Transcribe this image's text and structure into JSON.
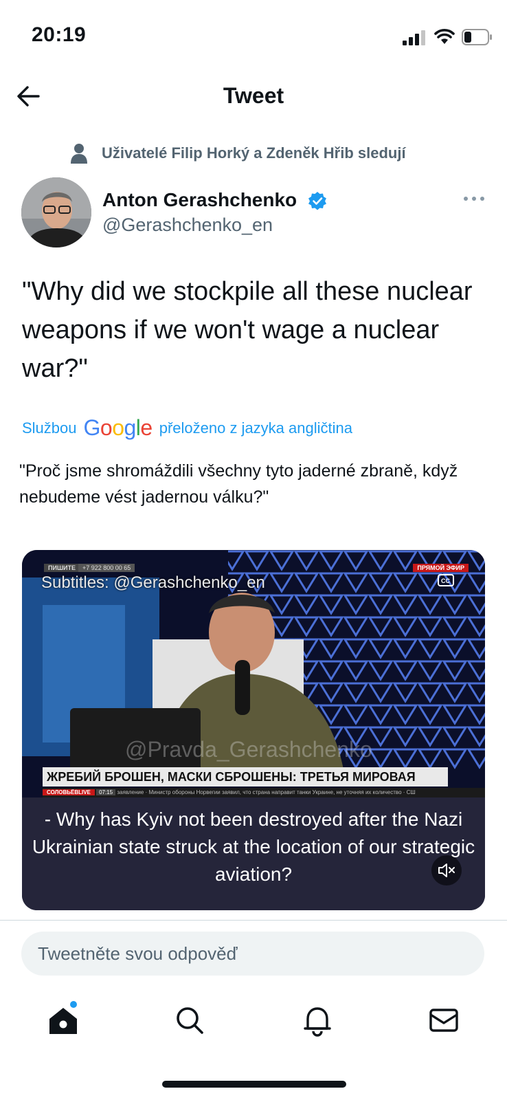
{
  "status_bar": {
    "time": "20:19",
    "icons": [
      "signal-icon",
      "wifi-icon",
      "battery-icon"
    ]
  },
  "header": {
    "title": "Tweet",
    "back_icon": "arrow-left-icon"
  },
  "social_context": {
    "icon": "person-icon",
    "text": "Uživatelé Filip Horký a Zdeněk Hřib sledují"
  },
  "author": {
    "name": "Anton Gerashchenko",
    "handle": "@Gerashchenko_en",
    "verified": true
  },
  "tweet": {
    "text": "\"Why did we stockpile all these nuclear weapons if we won't wage a nuclear war?\"",
    "translation": {
      "prefix": "Službou",
      "provider": "Google",
      "suffix": "přeloženo z jazyka angličtina",
      "text": "\"Proč jsme shromáždili všechny tyto jaderné zbraně, když nebudeme vést jadernou válku?\""
    }
  },
  "video": {
    "top_label": "ПИШИТЕ",
    "phone": "+7 922 800 00 65",
    "live_badge": "ПРЯМОЙ ЭФИР",
    "subtitle_credit": "Subtitles: @Gerashchenko_en",
    "watermark": "@Pravda_Gerashchenko",
    "banner": "ЖРЕБИЙ БРОШЕН, МАСКИ СБРОШЕНЫ: ТРЕТЬЯ МИРОВАЯ",
    "ticker_brand": "СОЛОВЬЁВLIVE",
    "ticker_time": "07:15",
    "ticker_text": "заявление · Министр обороны Норвегии заявил, что страна направит танки Украине, не уточняя их количество · СШ",
    "caption": "- Why has Kyiv not been destroyed after the Nazi Ukrainian state struck at the location of our strategic aviation?"
  },
  "reply": {
    "placeholder": "Tweetněte svou odpověď"
  },
  "tab_bar": {
    "items": [
      "home-icon",
      "search-icon",
      "bell-icon",
      "mail-icon"
    ],
    "home_has_notification": true
  },
  "colors": {
    "accent": "#1d9bf0",
    "text_primary": "#0f1419",
    "text_secondary": "#536471"
  }
}
